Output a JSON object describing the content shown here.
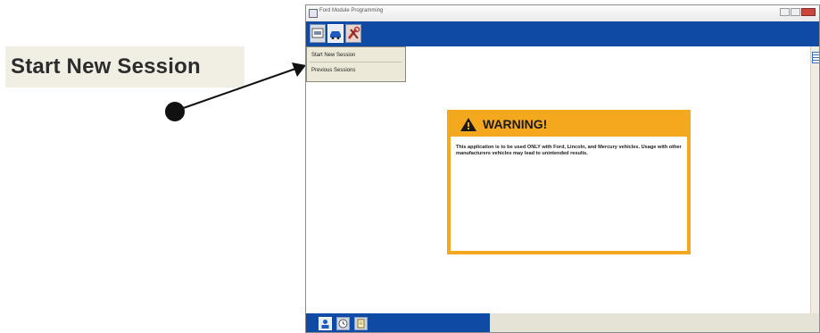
{
  "callout": {
    "label": "Start New Session"
  },
  "window": {
    "title": "Ford Module Programming",
    "toolbar": {
      "buttons": [
        {
          "icon": "vehicle-icon"
        },
        {
          "icon": "car-icon"
        },
        {
          "icon": "tools-icon"
        }
      ]
    },
    "menu": {
      "items": [
        {
          "label": "Start New Session"
        },
        {
          "label": "Previous Sessions"
        }
      ]
    },
    "warning": {
      "title": "WARNING!",
      "message": "This application is to be used ONLY with Ford, Lincoln, and Mercury vehicles. Usage with other manufacturers vehicles may lead to unintended results."
    },
    "statusbar": {
      "buttons": [
        {
          "icon": "users-icon"
        },
        {
          "icon": "clock-icon"
        },
        {
          "icon": "document-icon"
        }
      ]
    }
  },
  "colors": {
    "toolbar_blue": "#0f4aa4",
    "warning_orange": "#f4a81e",
    "window_bg": "#f5f4ee",
    "menu_bg": "#ece9d8"
  }
}
